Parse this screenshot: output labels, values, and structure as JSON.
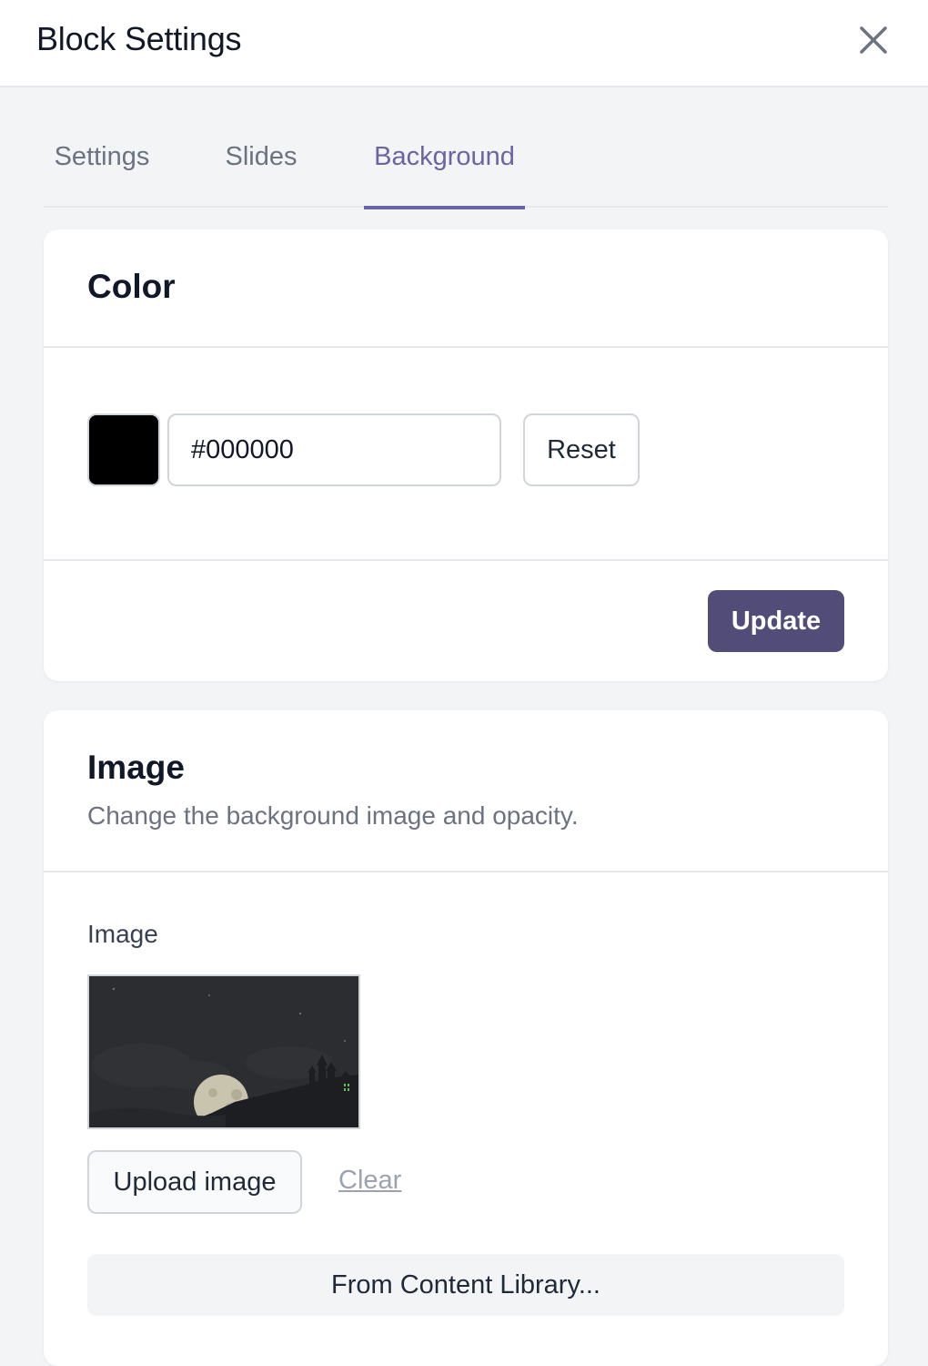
{
  "header": {
    "title": "Block Settings"
  },
  "tabs": [
    {
      "label": "Settings"
    },
    {
      "label": "Slides"
    },
    {
      "label": "Background"
    }
  ],
  "active_tab": "Background",
  "color_section": {
    "title": "Color",
    "swatch_color": "#000000",
    "hex_value": "#000000",
    "reset_label": "Reset",
    "update_label": "Update"
  },
  "image_section": {
    "title": "Image",
    "description": "Change the background image and opacity.",
    "field_label": "Image",
    "upload_label": "Upload image",
    "clear_label": "Clear",
    "library_label": "From Content Library..."
  },
  "colors": {
    "accent": "#6b64a4",
    "primary_button": "#514d78"
  },
  "icons": [
    "close-icon"
  ]
}
